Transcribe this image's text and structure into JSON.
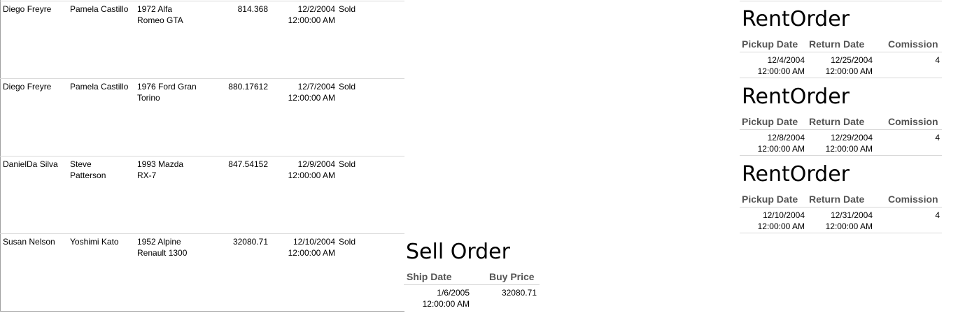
{
  "orders": [
    {
      "seller": "Diego Freyre",
      "buyer": "Pamela Castillo",
      "car": "1972 Alfa\nRomeo GTA",
      "price": "814.368",
      "date": "12/2/2004\n12:00:00 AM",
      "status": "Sold"
    },
    {
      "seller": "Diego Freyre",
      "buyer": "Pamela Castillo",
      "car": "1976 Ford Gran\nTorino",
      "price": "880.17612",
      "date": "12/7/2004\n12:00:00 AM",
      "status": "Sold"
    },
    {
      "seller": "DanielDa Silva",
      "buyer": "Steve\nPatterson",
      "car": "1993 Mazda\nRX-7",
      "price": "847.54152",
      "date": "12/9/2004\n12:00:00 AM",
      "status": "Sold"
    },
    {
      "seller": "Susan Nelson",
      "buyer": "Yoshimi Kato",
      "car": "1952 Alpine\nRenault 1300",
      "price": "32080.71",
      "date": "12/10/2004\n12:00:00 AM",
      "status": "Sold"
    }
  ],
  "rent_orders": [
    {
      "title": "RentOrder",
      "pickup_label": "Pickup Date",
      "return_label": "Return Date",
      "commission_label": "Comission",
      "pickup": "12/4/2004\n12:00:00 AM",
      "return": "12/25/2004\n12:00:00 AM",
      "commission": "4"
    },
    {
      "title": "RentOrder",
      "pickup_label": "Pickup Date",
      "return_label": "Return Date",
      "commission_label": "Comission",
      "pickup": "12/8/2004\n12:00:00 AM",
      "return": "12/29/2004\n12:00:00 AM",
      "commission": "4"
    },
    {
      "title": "RentOrder",
      "pickup_label": "Pickup Date",
      "return_label": "Return Date",
      "commission_label": "Comission",
      "pickup": "12/10/2004\n12:00:00 AM",
      "return": "12/31/2004\n12:00:00 AM",
      "commission": "4"
    }
  ],
  "sell_order": {
    "title": "Sell Order",
    "ship_label": "Ship Date",
    "price_label": "Buy Price",
    "ship": "1/6/2005\n12:00:00 AM",
    "price": "32080.71"
  }
}
